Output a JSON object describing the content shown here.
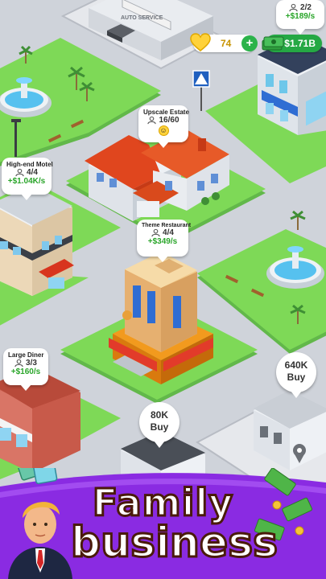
{
  "hud": {
    "coins": "74",
    "coins_add": "+",
    "cash": "$1.71B"
  },
  "buildings": {
    "top_right": {
      "occupancy": "2/2",
      "income": "+$189/s"
    },
    "upscale_estate": {
      "name": "Upscale Estate",
      "occupancy": "16/60"
    },
    "motel": {
      "name": "High-end Motel",
      "occupancy": "4/4",
      "income": "+$1.04K/s"
    },
    "restaurant": {
      "name": "Theme Restaurant",
      "occupancy": "4/4",
      "income": "+$349/s"
    },
    "diner": {
      "name": "Large Diner",
      "occupancy": "3/3",
      "income": "+$160/s"
    },
    "auto_service": {
      "sign": "AUTO SERVICE"
    }
  },
  "buy_offers": {
    "right": {
      "price": "640K",
      "label": "Buy"
    },
    "center": {
      "price": "80K",
      "label": "Buy"
    }
  },
  "title": {
    "line1": "Family",
    "line2": "business"
  },
  "colors": {
    "grass": "#7ed957",
    "road": "#cfd3da",
    "banner": "#8a2be2",
    "cash_green": "#25a844"
  }
}
